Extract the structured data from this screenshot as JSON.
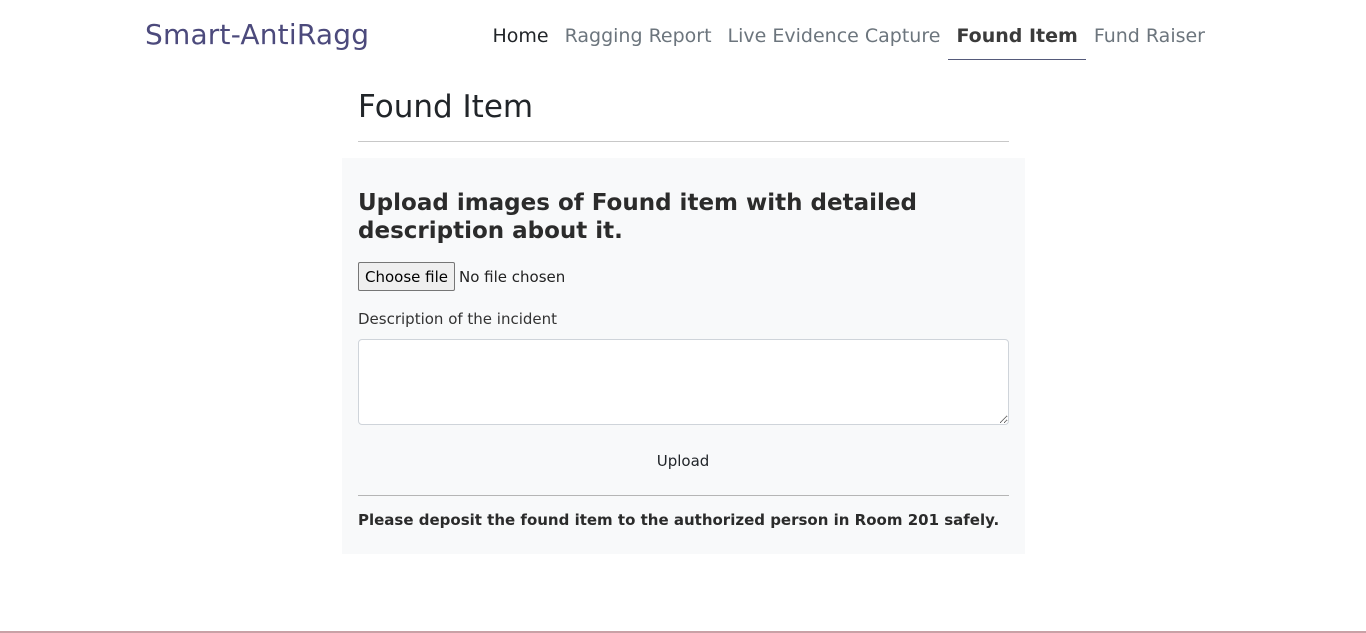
{
  "navbar": {
    "brand": "Smart-AntiRagg",
    "links": [
      {
        "label": "Home"
      },
      {
        "label": "Ragging Report"
      },
      {
        "label": "Live Evidence Capture"
      },
      {
        "label": "Found Item",
        "active": true
      },
      {
        "label": "Fund Raiser"
      }
    ]
  },
  "page": {
    "title": "Found Item"
  },
  "form": {
    "heading": "Upload images of Found item with detailed description about it.",
    "file_button_label": "Choose file",
    "file_status": "No file chosen",
    "description_label": "Description of the incident",
    "description_value": "",
    "upload_label": "Upload",
    "notice": "Please deposit the found item to the authorized person in Room 201 safely."
  },
  "colors": {
    "brand": "#4c4a7c",
    "panel_background": "#f8f9fa",
    "active_underline": "#555a7a"
  }
}
